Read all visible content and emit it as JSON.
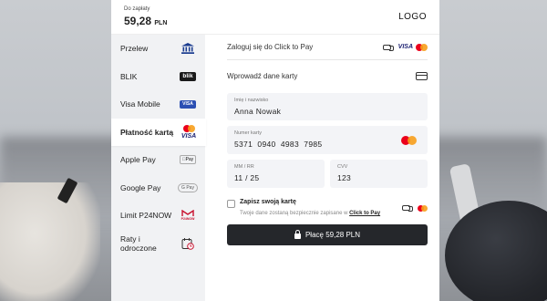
{
  "header": {
    "amount_label": "Do zapłaty",
    "amount": "59,28",
    "currency": "PLN",
    "logo": "LOGO"
  },
  "sidebar": {
    "items": [
      {
        "label": "Przelew",
        "icon": "bank-icon"
      },
      {
        "label": "BLIK",
        "icon": "blik-icon",
        "badge": "blik"
      },
      {
        "label": "Visa Mobile",
        "icon": "visa-mobile-icon",
        "badge": "VISA"
      },
      {
        "label": "Płatność kartą",
        "icon": "card-brands-icon",
        "active": true,
        "badge": "VISA"
      },
      {
        "label": "Apple Pay",
        "icon": "apple-pay-icon",
        "badge": "Pay"
      },
      {
        "label": "Google Pay",
        "icon": "google-pay-icon",
        "badge": "G Pay"
      },
      {
        "label": "Limit P24NOW",
        "icon": "p24now-icon",
        "badge": "P24NOW"
      },
      {
        "label": "Raty i odroczone",
        "icon": "calendar-clock-icon"
      }
    ]
  },
  "click_to_pay": {
    "label": "Zaloguj się do Click to Pay",
    "visa": "VISA"
  },
  "new_card": {
    "label": "Wprowadź dane karty"
  },
  "form": {
    "name": {
      "label": "Imię i nazwisko",
      "value": "Anna Nowak"
    },
    "number": {
      "label": "Numer karty",
      "value": "5371  0940  4983  7985"
    },
    "expiry": {
      "label": "MM / RR",
      "value": "11 / 25"
    },
    "cvv": {
      "label": "CVV",
      "value": "123"
    }
  },
  "save_card": {
    "title": "Zapisz swoją kartę",
    "desc": "Twoje dane zostaną bezpiecznie zapisane w",
    "link": "Click to Pay"
  },
  "pay_button": {
    "label": "Płacę 59,28 PLN"
  },
  "colors": {
    "button_bg": "#25272b",
    "mastercard_red": "#eb001b",
    "mastercard_orange": "#f79e1b",
    "visa_blue": "#1a1f71"
  }
}
